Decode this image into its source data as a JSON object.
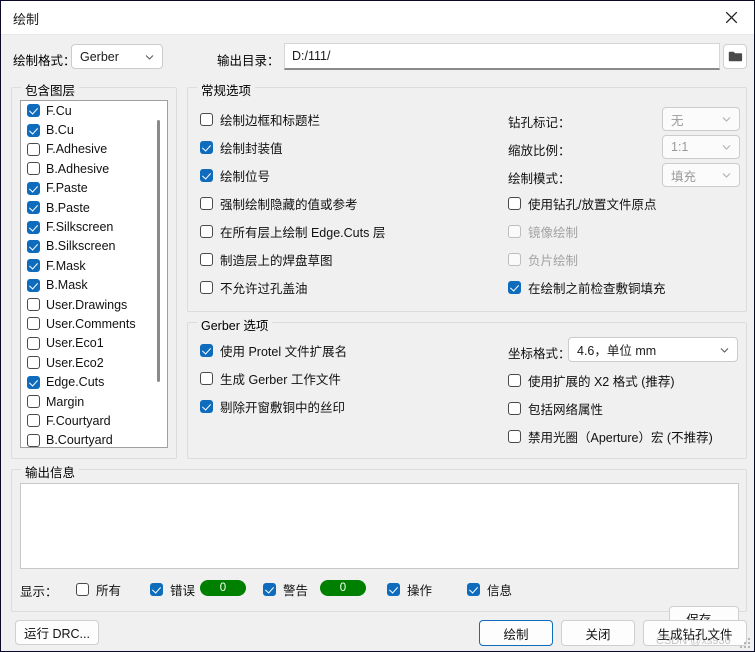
{
  "window": {
    "title": "绘制",
    "close_icon": "close-icon"
  },
  "toolbar": {
    "plot_format_label": "绘制格式：",
    "plot_format_value": "Gerber",
    "output_dir_label": "输出目录：",
    "output_dir_value": "D:/111/",
    "output_dir_placeholder": "",
    "browse_icon": "folder-icon"
  },
  "layers_group": {
    "legend": "包含图层",
    "items": [
      {
        "label": "F.Cu",
        "checked": true
      },
      {
        "label": "B.Cu",
        "checked": true
      },
      {
        "label": "F.Adhesive",
        "checked": false
      },
      {
        "label": "B.Adhesive",
        "checked": false
      },
      {
        "label": "F.Paste",
        "checked": true
      },
      {
        "label": "B.Paste",
        "checked": true
      },
      {
        "label": "F.Silkscreen",
        "checked": true
      },
      {
        "label": "B.Silkscreen",
        "checked": true
      },
      {
        "label": "F.Mask",
        "checked": true
      },
      {
        "label": "B.Mask",
        "checked": true
      },
      {
        "label": "User.Drawings",
        "checked": false
      },
      {
        "label": "User.Comments",
        "checked": false
      },
      {
        "label": "User.Eco1",
        "checked": false
      },
      {
        "label": "User.Eco2",
        "checked": false
      },
      {
        "label": "Edge.Cuts",
        "checked": true
      },
      {
        "label": "Margin",
        "checked": false
      },
      {
        "label": "F.Courtyard",
        "checked": false
      },
      {
        "label": "B.Courtyard",
        "checked": false
      }
    ]
  },
  "general_group": {
    "legend": "常规选项",
    "left_options": [
      {
        "label": "绘制边框和标题栏",
        "checked": false,
        "disabled": false
      },
      {
        "label": "绘制封装值",
        "checked": true,
        "disabled": false
      },
      {
        "label": "绘制位号",
        "checked": true,
        "disabled": false
      },
      {
        "label": "强制绘制隐藏的值或参考",
        "checked": false,
        "disabled": false
      },
      {
        "label": "在所有层上绘制 Edge.Cuts 层",
        "checked": false,
        "disabled": false
      },
      {
        "label": "制造层上的焊盘草图",
        "checked": false,
        "disabled": false
      },
      {
        "label": "不允许过孔盖油",
        "checked": false,
        "disabled": false
      }
    ],
    "drill_marks_label": "钻孔标记：",
    "drill_marks_value": "无",
    "scale_label": "缩放比例：",
    "scale_value": "1:1",
    "plot_mode_label": "绘制模式：",
    "plot_mode_value": "填充",
    "right_options": [
      {
        "label": "使用钻孔/放置文件原点",
        "checked": false,
        "disabled": false
      },
      {
        "label": "镜像绘制",
        "checked": false,
        "disabled": true
      },
      {
        "label": "负片绘制",
        "checked": false,
        "disabled": true
      },
      {
        "label": "在绘制之前检查敷铜填充",
        "checked": true,
        "disabled": false
      }
    ]
  },
  "gerber_group": {
    "legend": "Gerber 选项",
    "left_options": [
      {
        "label": "使用 Protel 文件扩展名",
        "checked": true,
        "disabled": false
      },
      {
        "label": "生成 Gerber 工作文件",
        "checked": false,
        "disabled": false
      },
      {
        "label": "剔除开窗敷铜中的丝印",
        "checked": true,
        "disabled": false
      }
    ],
    "coord_format_label": "坐标格式：",
    "coord_format_value": "4.6，单位 mm",
    "right_options": [
      {
        "label": "使用扩展的 X2 格式 (推荐)",
        "checked": false,
        "disabled": false
      },
      {
        "label": "包括网络属性",
        "checked": false,
        "disabled": false
      },
      {
        "label": "禁用光圈（Aperture）宏 (不推荐)",
        "checked": false,
        "disabled": false
      }
    ]
  },
  "output_group": {
    "legend": "输出信息",
    "log_text": "",
    "show_label": "显示：",
    "filters": [
      {
        "label": "所有",
        "checked": false,
        "badge": null
      },
      {
        "label": "错误",
        "checked": true,
        "badge": "0"
      },
      {
        "label": "警告",
        "checked": true,
        "badge": "0"
      },
      {
        "label": "操作",
        "checked": true,
        "badge": null
      },
      {
        "label": "信息",
        "checked": true,
        "badge": null
      }
    ],
    "save_label": "保存..."
  },
  "footer": {
    "run_drc_label": "运行 DRC...",
    "plot_label": "绘制",
    "close_label": "关闭",
    "gen_drill_label": "生成钻孔文件",
    "watermark": "CSDN @xs930"
  },
  "colors": {
    "accent": "#0f6cbd",
    "badge_green": "#008000",
    "dialog_bg": "#f0f0f0"
  }
}
